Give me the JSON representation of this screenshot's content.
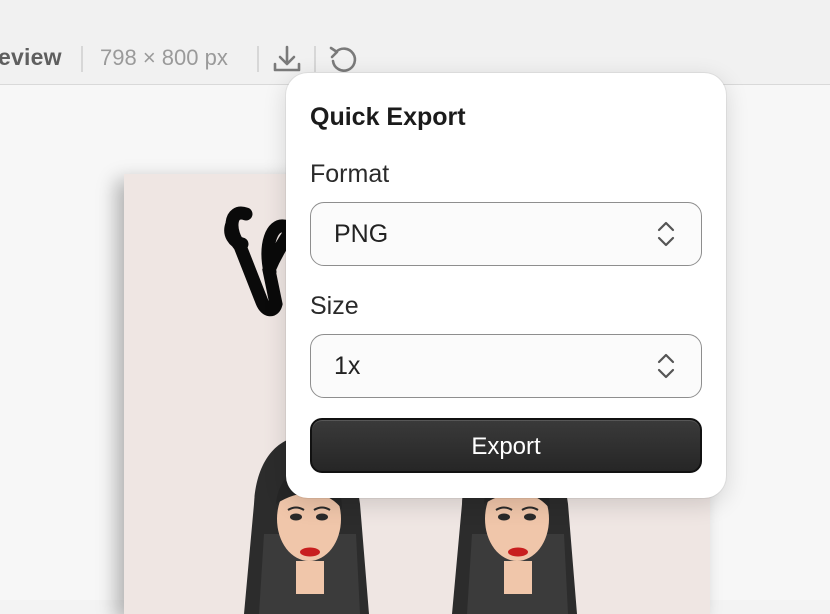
{
  "toolbar": {
    "title": "eview",
    "dimensions": "798 × 800 px",
    "download_icon": "download-icon",
    "refresh_icon": "refresh-icon"
  },
  "popover": {
    "title": "Quick Export",
    "format": {
      "label": "Format",
      "value": "PNG",
      "icon": "chevron-updown-icon"
    },
    "size": {
      "label": "Size",
      "value": "1x",
      "icon": "chevron-updown-icon"
    },
    "export_label": "Export"
  },
  "colors": {
    "toolbar_bg": "#f1f1f1",
    "artboard_bg": "#efe6e3",
    "button_bg": "#2d2d2d",
    "lips": "#c81e1e"
  }
}
